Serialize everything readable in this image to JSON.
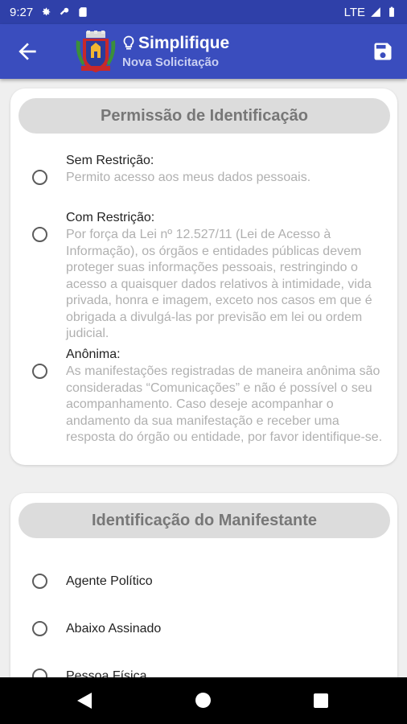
{
  "status_bar": {
    "time": "9:27",
    "network": "LTE",
    "icons": [
      "gear-icon",
      "key-icon",
      "sd-card-icon",
      "signal-icon",
      "battery-icon"
    ]
  },
  "app_bar": {
    "title": "Simplifique",
    "subtitle": "Nova Solicitação",
    "icons": [
      "back-arrow-icon",
      "coat-of-arms-logo",
      "lightbulb-icon",
      "save-icon"
    ],
    "colors": {
      "primary": "#3a4dbe",
      "status": "#2f40a9"
    }
  },
  "permission_card": {
    "header": "Permissão de Identificação",
    "options": [
      {
        "title": "Sem Restrição:",
        "description": "Permito acesso aos meus dados pessoais."
      },
      {
        "title": "Com Restrição:",
        "description": "Por força da Lei nº 12.527/11 (Lei de Acesso à Informação), os órgãos e entidades públicas devem proteger suas informações pessoais, restringindo o acesso a quaisquer dados relativos à intimidade, vida privada, honra e imagem, exceto nos casos em que é obrigada a divulgá-las por previsão em lei ou ordem judicial."
      },
      {
        "title": "Anônima:",
        "description": "As manifestações registradas de maneira anônima são consideradas “Comunicações” e não é possível o seu acompanhamento. Caso deseje acompanhar o andamento da sua manifestação e receber uma resposta do órgão ou entidade, por favor identifique-se."
      }
    ]
  },
  "identification_card": {
    "header": "Identificação do Manifestante",
    "options": [
      "Agente Político",
      "Abaixo Assinado",
      "Pessoa Física"
    ]
  },
  "nav_bar": {
    "icons": [
      "nav-back-icon",
      "nav-home-icon",
      "nav-recents-icon"
    ]
  }
}
